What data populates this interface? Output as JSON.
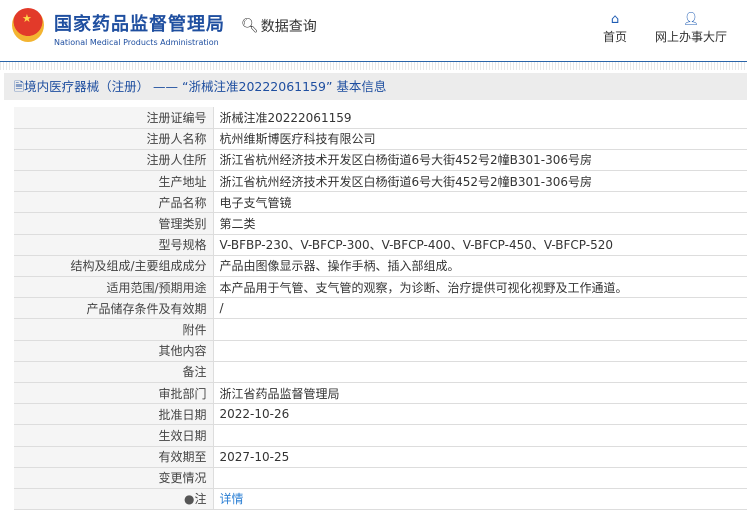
{
  "header": {
    "org_cn": "国家药品监督管理局",
    "org_en": "National Medical Products Administration",
    "query": "数据查询",
    "nav": [
      {
        "label": "首页",
        "icon": "home-icon"
      },
      {
        "label": "网上办事大厅",
        "icon": "user-icon"
      }
    ]
  },
  "title": "境内医疗器械（注册） —— “浙械注准20222061159” 基本信息",
  "rows": [
    {
      "label": "注册证编号",
      "value": "浙械注准20222061159"
    },
    {
      "label": "注册人名称",
      "value": "杭州维斯博医疗科技有限公司"
    },
    {
      "label": "注册人住所",
      "value": "浙江省杭州经济技术开发区白杨街道6号大街452号2幢B301-306号房"
    },
    {
      "label": "生产地址",
      "value": "浙江省杭州经济技术开发区白杨街道6号大街452号2幢B301-306号房"
    },
    {
      "label": "产品名称",
      "value": "电子支气管镜"
    },
    {
      "label": "管理类别",
      "value": "第二类"
    },
    {
      "label": "型号规格",
      "value": "V-BFBP-230、V-BFCP-300、V-BFCP-400、V-BFCP-450、V-BFCP-520"
    },
    {
      "label": "结构及组成/主要组成成分",
      "value": "产品由图像显示器、操作手柄、插入部组成。"
    },
    {
      "label": "适用范围/预期用途",
      "value": "本产品用于气管、支气管的观察，为诊断、治疗提供可视化视野及工作通道。"
    },
    {
      "label": "产品储存条件及有效期",
      "value": "/"
    },
    {
      "label": "附件",
      "value": ""
    },
    {
      "label": "其他内容",
      "value": ""
    },
    {
      "label": "备注",
      "value": ""
    },
    {
      "label": "审批部门",
      "value": "浙江省药品监督管理局"
    },
    {
      "label": "批准日期",
      "value": "2022-10-26"
    },
    {
      "label": "生效日期",
      "value": ""
    },
    {
      "label": "有效期至",
      "value": "2027-10-25"
    },
    {
      "label": "变更情况",
      "value": ""
    }
  ],
  "note": {
    "label": "注",
    "link": "详情"
  }
}
